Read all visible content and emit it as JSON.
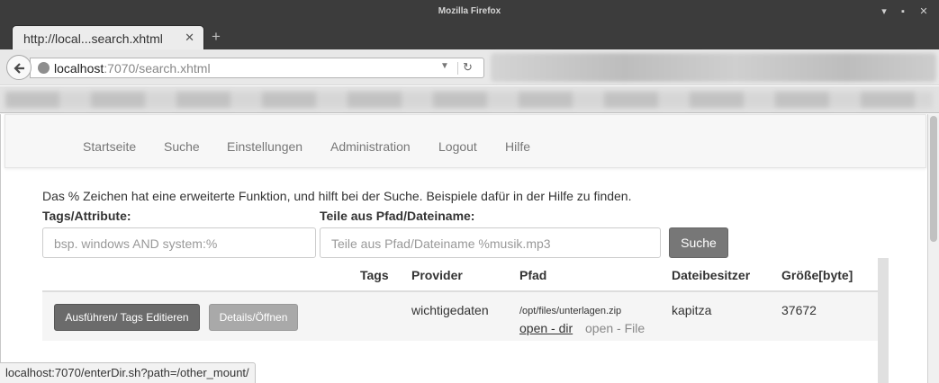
{
  "window": {
    "title": "Mozilla Firefox",
    "minimize": "▾",
    "maximize": "▪",
    "close": "✕"
  },
  "tab": {
    "label": "http://local...search.xhtml",
    "close": "✕",
    "new_tab": "+"
  },
  "urlbar": {
    "host": "localhost",
    "rest": ":7070/search.xhtml",
    "dropdown": "▼",
    "reload": "↻"
  },
  "nav": [
    "Startseite",
    "Suche",
    "Einstellungen",
    "Administration",
    "Logout",
    "Hilfe"
  ],
  "search": {
    "hint": "Das % Zeichen hat eine erweiterte Funktion, und hilft bei der Suche. Beispiele dafür in der Hilfe zu finden.",
    "tags_label": "Tags/Attribute:",
    "path_label": "Teile aus Pfad/Dateiname:",
    "tags_placeholder": "bsp. windows AND system:%",
    "path_placeholder": "Teile aus Pfad/Dateiname  %musik.mp3",
    "button": "Suche"
  },
  "table": {
    "headers": {
      "tags": "Tags",
      "provider": "Provider",
      "path": "Pfad",
      "owner": "Dateibesitzer",
      "size": "Größe[byte]"
    },
    "rows": [
      {
        "btn_execute": "Ausführen/ Tags Editieren",
        "btn_details": "Details/Öffnen",
        "provider": "wichtigedaten",
        "path": "/opt/files/unterlagen.zip",
        "open_dir": "open - dir",
        "open_file": "open - File",
        "owner": "kapitza",
        "size": "37672"
      }
    ]
  },
  "status": "localhost:7070/enterDir.sh?path=/other_mount/"
}
